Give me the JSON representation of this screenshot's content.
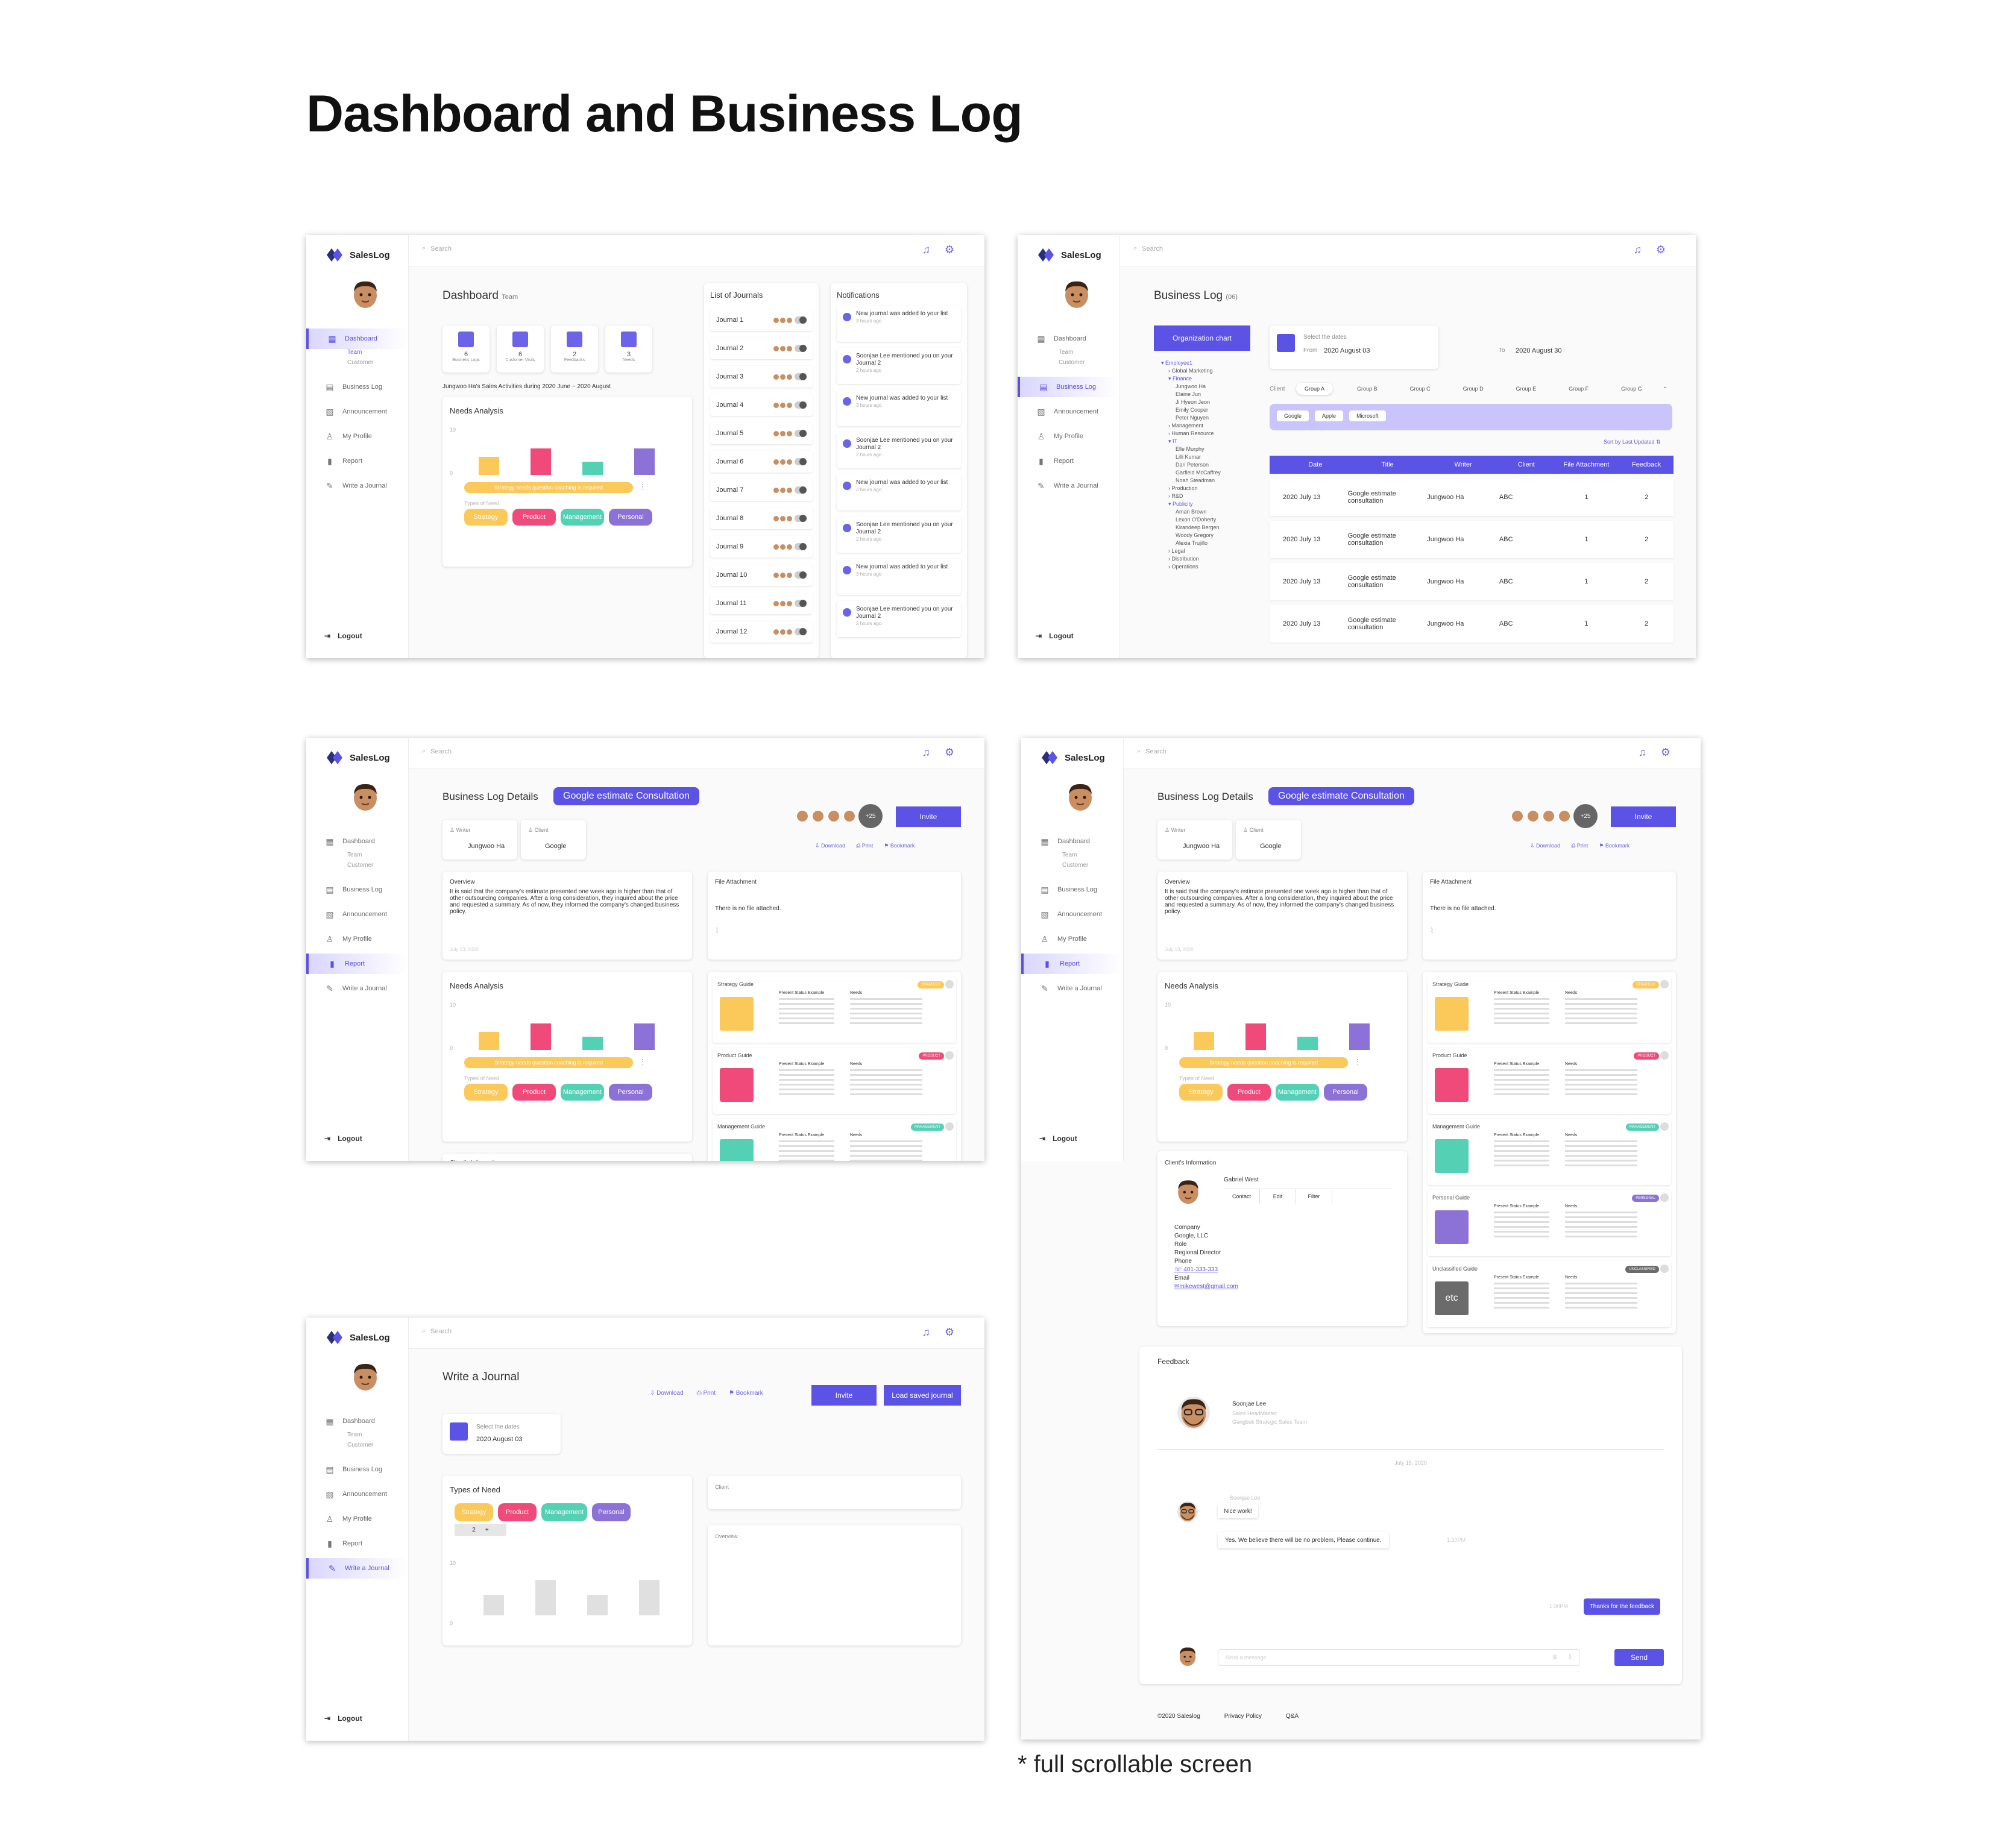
{
  "page_title": "Dashboard and Business Log",
  "footnote": "* full scrollable screen",
  "app": {
    "logo": "SalesLog",
    "search_placeholder": "Search",
    "nav": {
      "dashboard": "Dashboard",
      "team": "Team",
      "customer": "Customer",
      "business_log": "Business Log",
      "announcement": "Announcement",
      "my_profile": "My Profile",
      "report": "Report",
      "write_journal": "Write a Journal",
      "logout": "Logout"
    },
    "accent": "#5b52e6"
  },
  "dashboard": {
    "title": "Dashboard",
    "subtitle": "Team",
    "stats": [
      {
        "value": "6",
        "label": "Business Logs"
      },
      {
        "value": "6",
        "label": "Customer Visits"
      },
      {
        "value": "2",
        "label": "Feedbacks"
      },
      {
        "value": "3",
        "label": "Needs"
      }
    ],
    "activity_caption": "Jungwoo Ha's Sales Activities during 2020 June ~ 2020 August",
    "journals_title": "List of Journals",
    "journals": [
      "Journal 1",
      "Journal 2",
      "Journal 3",
      "Journal 4",
      "Journal 5",
      "Journal 6",
      "Journal 7",
      "Journal 8",
      "Journal 9",
      "Journal 10",
      "Journal  11",
      "Journal 12"
    ],
    "notifications_title": "Notifications",
    "notifications": [
      {
        "text": "New journal was added to your list",
        "ago": "3 hours ago"
      },
      {
        "text": "Soonjae Lee mentioned you on your Journal 2",
        "ago": "2 hours ago"
      },
      {
        "text": "New journal was added to your list",
        "ago": "3 hours ago"
      },
      {
        "text": "Soonjae Lee mentioned you on your Journal 2",
        "ago": "2 hours ago"
      },
      {
        "text": "New journal was added to your list",
        "ago": "3 hours ago"
      },
      {
        "text": "Soonjae Lee mentioned you on your Journal 2",
        "ago": "2 hours ago"
      },
      {
        "text": "New journal was added to your list",
        "ago": "3 hours ago"
      },
      {
        "text": "Soonjae Lee mentioned you on your Journal 2",
        "ago": "2 hours ago"
      }
    ]
  },
  "needs": {
    "title": "Needs Analysis",
    "ymax": "10",
    "ymin": "0",
    "values": [
      4,
      6,
      3,
      6
    ],
    "colors": [
      "#fbc85a",
      "#f04a7a",
      "#54d0b5",
      "#8c72d6"
    ],
    "banner": "Strategy needs question coaching is required",
    "types_label": "Types of Need",
    "types": [
      "Strategy",
      "Product",
      "Management",
      "Personal"
    ]
  },
  "business_log": {
    "title": "Business Log",
    "count": "(06)",
    "org_button": "Organization chart",
    "tree": [
      "Employee1",
      "Global Marketing",
      "Finance",
      "Jungwoo Ha",
      "Elaine Jun",
      "Ji Hyeon Jeon",
      "Emily Cooper",
      "Peter Nguyen",
      "Management",
      "Human Resource",
      "IT",
      "Elle Murphy",
      "Lilli Kumar",
      "Dan Peterson",
      "Garfield McCaffrey",
      "Noah Steadman",
      "Production",
      "R&D",
      "Publicity",
      "Aman Brown",
      "Lexon O'Doherty",
      "Kirandeep Bergen",
      "Woody Gregory",
      "Alexia Trujillo",
      "Legal",
      "Distribution",
      "Operations"
    ],
    "date_label": "Select the dates",
    "from_label": "From",
    "from": "2020 August 03",
    "to_label": "To",
    "to": "2020 August 30",
    "client_label": "Client",
    "groups": [
      "Group A",
      "Group B",
      "Group C",
      "Group D",
      "Group E",
      "Group F",
      "Group G"
    ],
    "clients": [
      "Google",
      "Apple",
      "Microsoft"
    ],
    "sort_label": "Sort by Last Updated",
    "columns": [
      "Date",
      "Title",
      "Writer",
      "Client",
      "File Attachment",
      "Feedback"
    ],
    "rows": [
      [
        "2020 July 13",
        "Google estimate consultation",
        "Jungwoo Ha",
        "ABC",
        "1",
        "2"
      ],
      [
        "2020 July 13",
        "Google estimate consultation",
        "Jungwoo Ha",
        "ABC",
        "1",
        "2"
      ],
      [
        "2020 July 13",
        "Google estimate consultation",
        "Jungwoo Ha",
        "ABC",
        "1",
        "2"
      ],
      [
        "2020 July 13",
        "Google estimate consultation",
        "Jungwoo Ha",
        "ABC",
        "1",
        "2"
      ]
    ]
  },
  "details": {
    "title": "Business Log Details",
    "tag": "Google estimate Consultation",
    "more_count": "+25",
    "invite": "Invite",
    "download": "Download",
    "print": "Print",
    "bookmark": "Bookmark",
    "writer_label": "Writer",
    "writer": "Jungwoo Ha",
    "client_label": "Client",
    "client": "Google",
    "overview_label": "Overview",
    "overview": "It is said that the company's estimate presented one week ago is higher than that of other outsourcing companies. After a long consideration, they inquired about the price and requested a summary. As of now, they informed the company's changed business policy.",
    "overview_date": "July 13, 2020",
    "file_label": "File Attachment",
    "file_none": "There is no file attached.",
    "guides": [
      {
        "name": "Strategy Guide",
        "badge": "STRATEGY",
        "color": "#fbc85a"
      },
      {
        "name": "Product Guide",
        "badge": "PRODUCT",
        "color": "#f04a7a"
      },
      {
        "name": "Management Guide",
        "badge": "MANAGEMENT",
        "color": "#54d0b5"
      },
      {
        "name": "Personal Guide",
        "badge": "PERSONAL",
        "color": "#8c72d6"
      },
      {
        "name": "Unclassified Guide",
        "badge": "UNCLASSIFIED",
        "color": "#6b6b6b"
      }
    ],
    "guide_col1": "Present Status Example",
    "guide_col2": "Needs",
    "etc": "etc",
    "client_info_label": "Client's Information",
    "client_name": "Gabriel West",
    "client_actions": [
      "Contact",
      "Edit",
      "Filter"
    ],
    "company_label": "Company",
    "company": "Google, LLC",
    "role_label": "Role",
    "role": "Regional Director",
    "phone_label": "Phone",
    "phone": "401-333-333",
    "email_label": "Email",
    "email": "mikewest@gmail.com",
    "client_info_cut": "Client's Information"
  },
  "feedback": {
    "title": "Feedback",
    "person": "Soonjae Lee",
    "person_role": "Sales HeadMaster",
    "person_team": "Gangbuk Strategic Sales Team",
    "date": "July 15, 2020",
    "sender": "Soonjae Lee",
    "msg1": "Nice work!",
    "msg2": "Yes. We believe there will be no problem, Please continue.",
    "time": "1:30PM",
    "reply": "Thanks for the feedback",
    "placeholder": "Send a message",
    "send": "Send"
  },
  "footer": {
    "copyright": "©2020 Saleslog",
    "privacy": "Privacy Policy",
    "qa": "Q&A"
  },
  "write": {
    "title": "Write a Journal",
    "download": "Download",
    "print": "Print",
    "bookmark": "Bookmark",
    "invite": "Invite",
    "load": "Load saved journal",
    "date_label": "Select the dates",
    "date": "2020 August 03",
    "types_title": "Types of Need",
    "types": [
      "Strategy",
      "Product",
      "Management",
      "Personal"
    ],
    "stepper_value": "2",
    "ymax": "10",
    "ymin": "0",
    "values": [
      4,
      7,
      4,
      7
    ],
    "client_label": "Client",
    "overview_label": "Overview"
  }
}
